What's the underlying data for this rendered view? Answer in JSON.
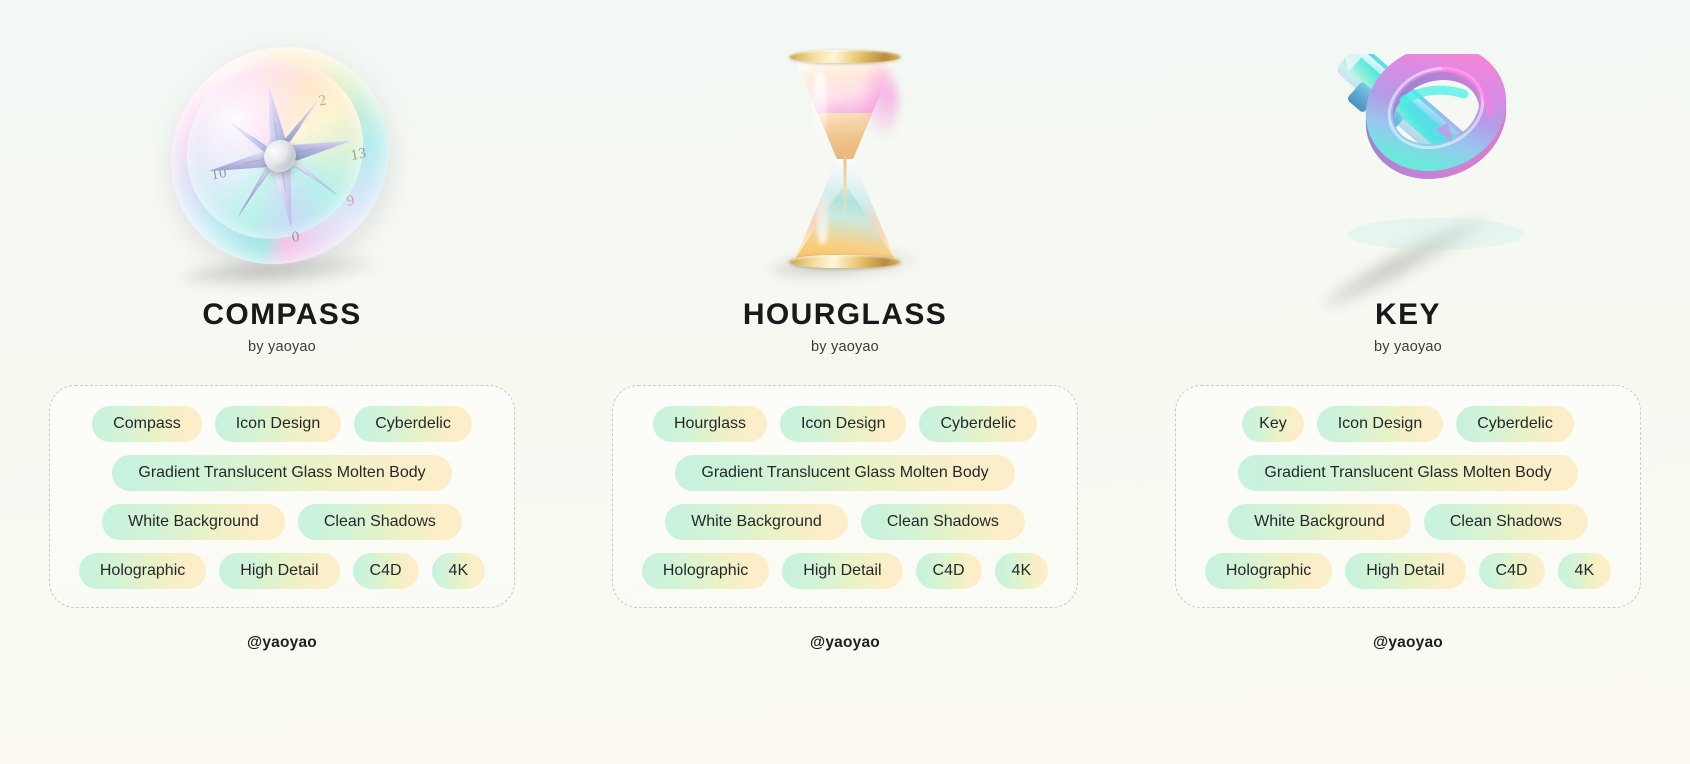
{
  "page": {
    "background_top": "#f2f8f4",
    "background_bottom": "#fbf9f1",
    "pill_gradient_from": "#c6f2de",
    "pill_gradient_to": "#fdeec9",
    "panel_border_color": "#c9cbc6",
    "title_color": "#191919"
  },
  "cards": [
    {
      "artwork": "compass-3d-glass-icon",
      "title": "COMPASS",
      "byline": "by yaoyao",
      "handle": "@yaoyao",
      "compass_numbers": [
        "10",
        "13",
        "0",
        "9",
        "2"
      ],
      "tag_rows": [
        [
          "Compass",
          "Icon Design",
          "Cyberdelic"
        ],
        [
          "Gradient Translucent Glass Molten Body"
        ],
        [
          "White Background",
          "Clean Shadows"
        ],
        [
          "Holographic",
          "High Detail",
          "C4D",
          "4K"
        ]
      ]
    },
    {
      "artwork": "hourglass-3d-glass-icon",
      "title": "HOURGLASS",
      "byline": "by yaoyao",
      "handle": "@yaoyao",
      "tag_rows": [
        [
          "Hourglass",
          "Icon Design",
          "Cyberdelic"
        ],
        [
          "Gradient Translucent Glass Molten Body"
        ],
        [
          "White Background",
          "Clean Shadows"
        ],
        [
          "Holographic",
          "High Detail",
          "C4D",
          "4K"
        ]
      ]
    },
    {
      "artwork": "key-3d-glass-icon",
      "title": "KEY",
      "byline": "by yaoyao",
      "handle": "@yaoyao",
      "tag_rows": [
        [
          "Key",
          "Icon Design",
          "Cyberdelic"
        ],
        [
          "Gradient Translucent Glass Molten Body"
        ],
        [
          "White Background",
          "Clean Shadows"
        ],
        [
          "Holographic",
          "High Detail",
          "C4D",
          "4K"
        ]
      ]
    }
  ]
}
